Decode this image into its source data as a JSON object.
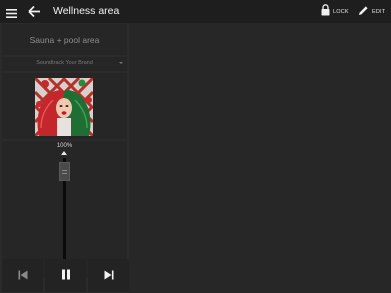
{
  "header": {
    "title": "Wellness area",
    "lock_label": "LOCK",
    "edit_label": "EDIT"
  },
  "icons": {
    "menu": "hamburger-menu-icon",
    "back": "arrow-left-icon",
    "lock": "padlock-icon",
    "edit": "pencil-icon",
    "previous": "skip-previous-icon",
    "pause": "pause-icon",
    "next": "skip-next-icon"
  },
  "zone": {
    "name": "Sauna + pool area"
  },
  "source": {
    "selected": "Soundtrack Your Brand"
  },
  "volume": {
    "label": "100%",
    "level": 1.0
  },
  "colors": {
    "background": "#272727",
    "topbar": "#1e1e1e",
    "panel": "#262626"
  }
}
